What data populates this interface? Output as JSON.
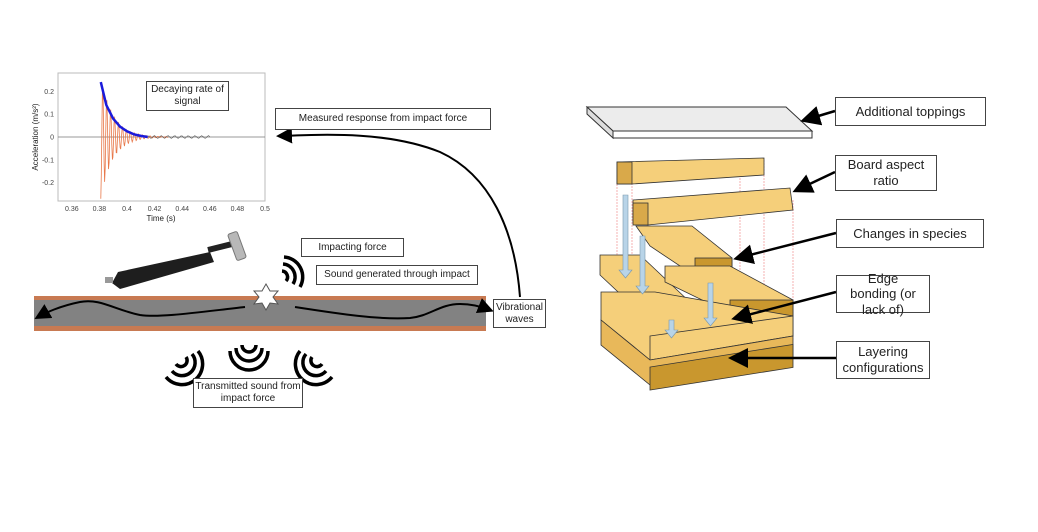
{
  "left_panel": {
    "chart_data": {
      "type": "line",
      "title": "",
      "xlabel": "Time (s)",
      "ylabel": "Acceleration (m/s²)",
      "xlim": [
        0.35,
        0.5
      ],
      "ylim": [
        -0.28,
        0.28
      ],
      "x_ticks": [
        "0.36",
        "0.38",
        "0.4",
        "0.42",
        "0.44",
        "0.46",
        "0.48",
        "0.5"
      ],
      "y_ticks": [
        "0.2",
        "0.1",
        "0",
        "-0.1",
        "-0.2"
      ],
      "series": [
        {
          "name": "Measured signal",
          "color": "#e8784a",
          "description": "Decaying oscillation starting at t≈0.381 s, peak ≈ ±0.27, decaying to ≈0 by t≈0.42 s"
        },
        {
          "name": "Decay envelope",
          "color": "#1a1adb",
          "x": [
            0.381,
            0.385,
            0.39,
            0.395,
            0.4,
            0.405,
            0.41,
            0.415
          ],
          "y": [
            0.24,
            0.14,
            0.08,
            0.045,
            0.025,
            0.012,
            0.005,
            0.0
          ]
        }
      ],
      "annotation": "Decaying rate of signal"
    },
    "labels": {
      "measured_response": "Measured response from impact force",
      "impacting_force": "Impacting force",
      "sound_generated": "Sound generated through impact",
      "vibrational_waves": "Vibrational waves",
      "transmitted_sound": "Transmitted sound from impact force"
    },
    "colors": {
      "slab": "#828282",
      "slab_edge": "#c87a52",
      "signal": "#e8784a",
      "envelope": "#1a1adb"
    }
  },
  "right_panel": {
    "labels": {
      "additional_toppings": "Additional toppings",
      "board_aspect_ratio": "Board aspect ratio",
      "changes_in_species": "Changes in species",
      "edge_bonding": "Edge bonding (or lack of)",
      "layering_configurations": "Layering configurations"
    },
    "colors": {
      "wood": "#f5cf7a",
      "wood_dark": "#d9a94a",
      "topping": "#ececec",
      "arrow": "#b8d4e8"
    }
  }
}
